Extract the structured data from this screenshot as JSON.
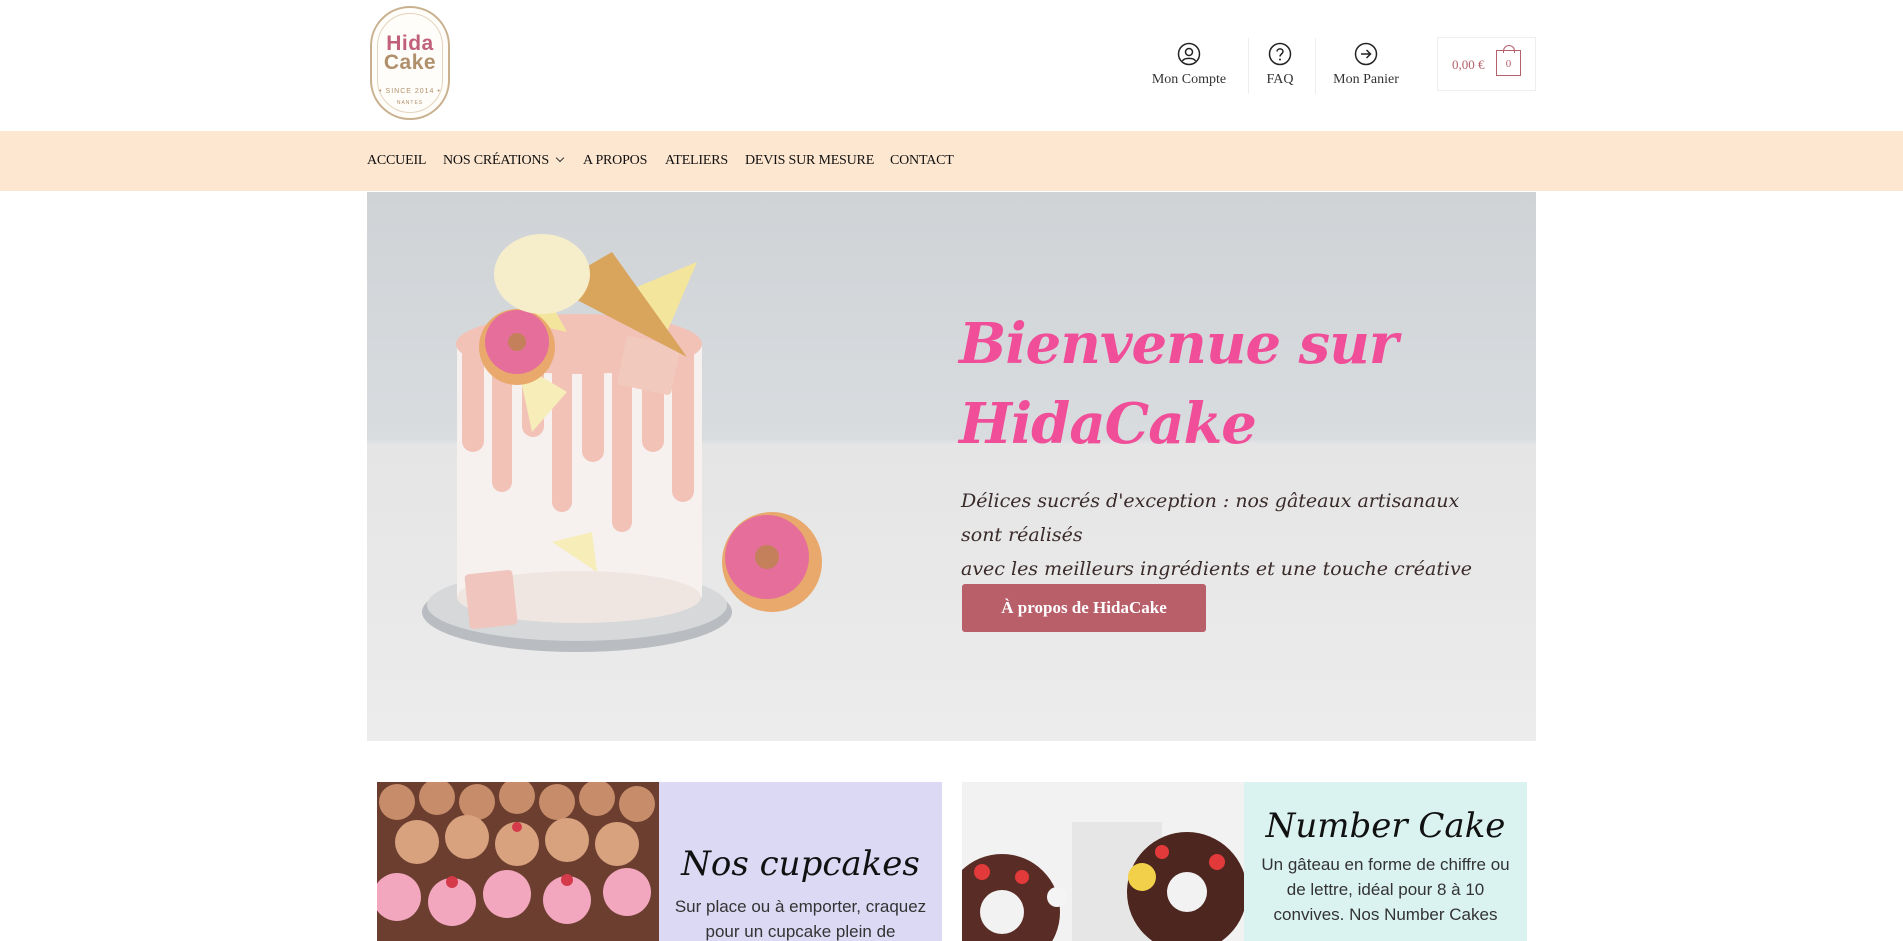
{
  "logo": {
    "line1": "Hida",
    "line2": "Cake",
    "since": "• SINCE 2014 •",
    "city": "NANTES"
  },
  "header_links": [
    {
      "label": "Mon Compte",
      "icon": "user-circle-icon"
    },
    {
      "label": "FAQ",
      "icon": "question-circle-icon"
    },
    {
      "label": "Mon Panier",
      "icon": "arrow-circle-icon"
    }
  ],
  "cart": {
    "amount": "0,00 €",
    "count": "0"
  },
  "nav": [
    {
      "label": "ACCUEIL"
    },
    {
      "label": "NOS CRÉATIONS",
      "dropdown": true
    },
    {
      "label": "A PROPOS"
    },
    {
      "label": "ATELIERS"
    },
    {
      "label": "DEVIS SUR MESURE"
    },
    {
      "label": "CONTACT"
    }
  ],
  "hero": {
    "title_line1": "Bienvenue sur",
    "title_line2": "HidaCake",
    "text_line1": "Délices sucrés d'exception : nos gâteaux artisanaux sont réalisés",
    "text_line2": "avec les meilleurs ingrédients et une touche créative unique.",
    "button": "À propos de HidaCake"
  },
  "cards": [
    {
      "title": "Nos cupcakes",
      "text": "Sur place ou à emporter, craquez pour un cupcake plein de",
      "bg": "#dcd9f5"
    },
    {
      "title": "Number Cake",
      "text": "Un gâteau en forme de chiffre ou de lettre, idéal pour 8 à 10 convives. Nos Number Cakes",
      "bg": "#daf3f1"
    }
  ],
  "colors": {
    "accent_pink": "#f04e98",
    "button": "#b85f6a",
    "nav_bg": "#fde7d0"
  }
}
